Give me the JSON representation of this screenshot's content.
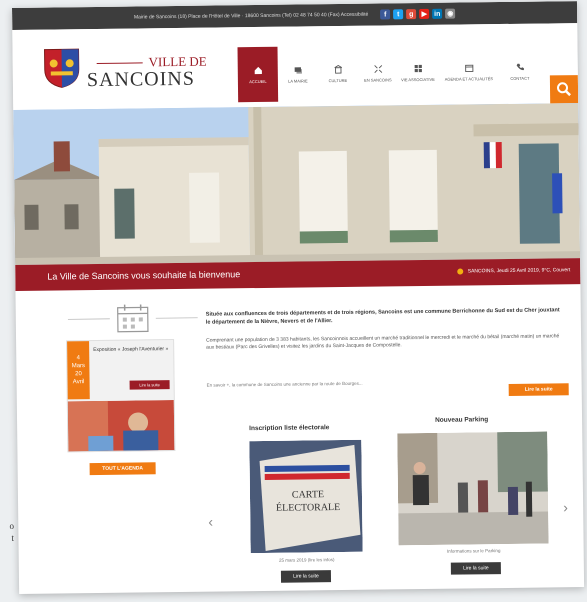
{
  "topbar": {
    "contact": "Mairie de Sancoins (18) Place de l'Hôtel de Ville · 18600 Sancoins (Tel) 02 48 74 50 40 (Fax) Accessibilité",
    "socials": [
      {
        "icon": "facebook-icon",
        "glyph": "f",
        "color": "#3b5998"
      },
      {
        "icon": "twitter-icon",
        "glyph": "t",
        "color": "#1da1f2"
      },
      {
        "icon": "google-plus-icon",
        "glyph": "g",
        "color": "#dd4b39"
      },
      {
        "icon": "youtube-icon",
        "glyph": "▶",
        "color": "#e62117"
      },
      {
        "icon": "linkedin-icon",
        "glyph": "in",
        "color": "#0077b5"
      },
      {
        "icon": "rss-icon",
        "glyph": "◉",
        "color": "#888888"
      }
    ]
  },
  "logo": {
    "line1": "Ville de",
    "line2": "Sancoins"
  },
  "nav": [
    {
      "label": "Accueil",
      "icon": "home-icon",
      "active": true
    },
    {
      "label": "La Mairie",
      "icon": "chat-icon",
      "active": false
    },
    {
      "label": "Culture",
      "icon": "building-icon",
      "active": false
    },
    {
      "label": "En Sancoins",
      "icon": "expand-icon",
      "active": false
    },
    {
      "label": "Vie Associative",
      "icon": "grid-icon",
      "active": false
    },
    {
      "label": "Agenda et Actualités",
      "icon": "calendar-icon",
      "active": false
    },
    {
      "label": "Contact",
      "icon": "phone-icon",
      "active": false
    }
  ],
  "welcome": {
    "text": "La Ville de Sancoins vous souhaite la bienvenue",
    "date": "SANCOINS, Jeudi 25 Avril 2019, 9°C, Couvert"
  },
  "event": {
    "day": "4",
    "month": "Mars",
    "rest": "20",
    "month2": "Avril",
    "title": "Exposition « Joseph l'Aventurier »",
    "more": "Lire la suite",
    "all_agenda": "Tout l'agenda"
  },
  "intro": {
    "bold": "Située aux confluences de trois départements et de trois régions, Sancoins est une commune Berrichonne du Sud est du Cher jouxtant le département de la Nièvre, Nevers et de l'Allier.",
    "text": "Comprenant une population de 3 383 habitants, les Sancoinnois accueillent un marché traditionnel le mercredi et le marché du bétail (marché matin) un marché aux bestiaux (Parc des Grivelles) et visitez les jardins du Saint-Jacques de Compostelle.",
    "small": "En savoir +, la commune de Sancoins une ancienne par la route de Bourges...",
    "more": "Lire la suite"
  },
  "news": [
    {
      "title": "Inscription liste électorale",
      "card_text": "CARTE ÉLECTORALE",
      "caption": "25 mars 2019 (lire les infos)",
      "button": "Lire la suite"
    },
    {
      "title": "Nouveau Parking",
      "caption": "Informations sur le Parking",
      "button": "Lire la suite"
    }
  ],
  "edge_text": "o\nt"
}
